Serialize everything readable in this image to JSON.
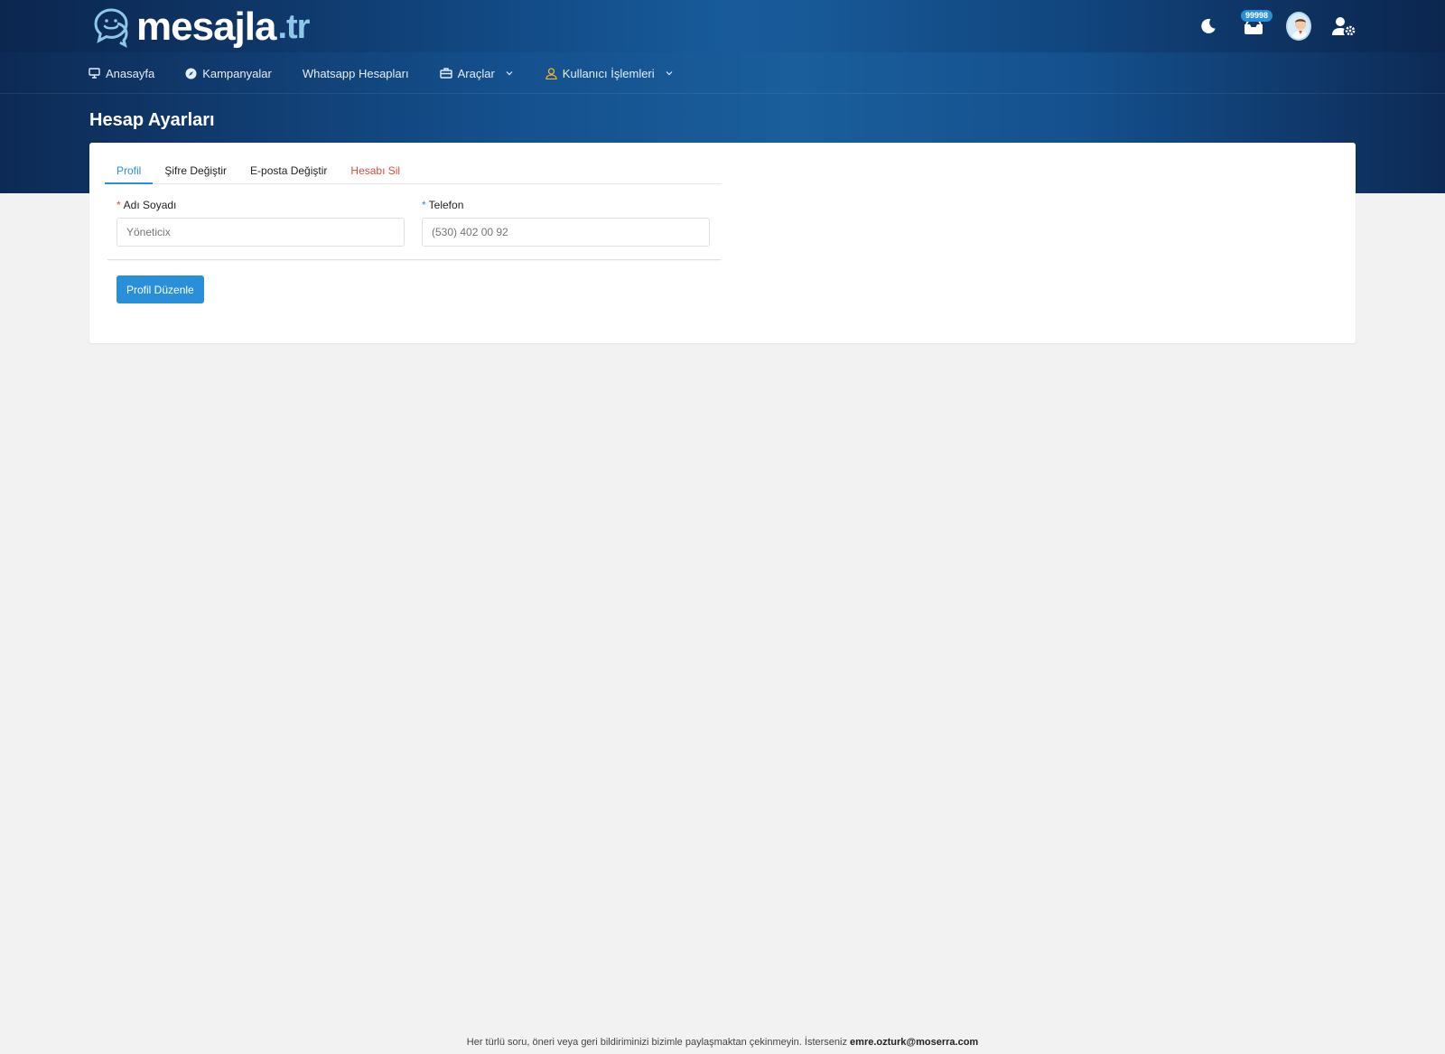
{
  "brand": {
    "name": "mesajla",
    "tld": ".tr"
  },
  "header": {
    "notification_count": "99998"
  },
  "nav": [
    {
      "label": "Anasayfa",
      "icon": "monitor-icon"
    },
    {
      "label": "Kampanyalar",
      "icon": "compass-icon"
    },
    {
      "label": "Whatsapp Hesapları",
      "icon": ""
    },
    {
      "label": "Araçlar",
      "icon": "briefcase-icon",
      "dropdown": true
    },
    {
      "label": "Kullanıcı İşlemleri",
      "icon": "user-icon",
      "dropdown": true
    }
  ],
  "page": {
    "title": "Hesap Ayarları"
  },
  "tabs": [
    {
      "label": "Profil",
      "active": true
    },
    {
      "label": "Şifre Değiştir"
    },
    {
      "label": "E-posta Değiştir"
    },
    {
      "label": "Hesabı Sil",
      "danger": true
    }
  ],
  "form": {
    "name": {
      "required": "*",
      "label": "Adı Soyadı",
      "placeholder": "Yöneticix"
    },
    "phone": {
      "required": "*",
      "label": "Telefon",
      "placeholder": "(530) 402 00 92"
    },
    "submit_label": "Profil Düzenle"
  },
  "footer": {
    "text": "Her türlü soru, öneri veya geri bildiriminizi bizimle paylaşmaktan çekinmeyin. İsterseniz ",
    "email": "emre.ozturk@moserra.com"
  },
  "colors": {
    "primary": "#2a8fd9",
    "danger": "#e04b3a",
    "header_dark": "#0d2a55",
    "header_mid": "#1a5e9c",
    "page_bg": "#f2f2f2"
  }
}
